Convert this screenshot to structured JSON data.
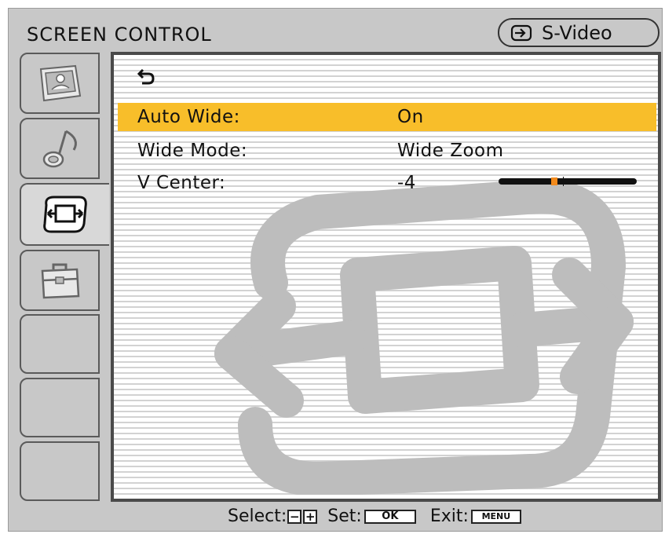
{
  "header": {
    "title": "SCREEN CONTROL",
    "source_icon": "input-arrow-icon",
    "source_label": "S-Video"
  },
  "sidebar": {
    "items": [
      {
        "icon": "picture-icon",
        "active": false
      },
      {
        "icon": "audio-icon",
        "active": false
      },
      {
        "icon": "screen-control-icon",
        "active": true
      },
      {
        "icon": "toolbox-icon",
        "active": false
      },
      {
        "icon": "",
        "active": false
      },
      {
        "icon": "",
        "active": false
      },
      {
        "icon": "",
        "active": false
      }
    ]
  },
  "menu": {
    "back_icon": "return-arrow-icon",
    "rows": [
      {
        "label": "Auto Wide:",
        "value": "On",
        "selected": true
      },
      {
        "label": "Wide Mode:",
        "value": "Wide Zoom",
        "selected": false
      },
      {
        "label": "V Center:",
        "value": "-4",
        "selected": false,
        "slider_level": -4
      }
    ]
  },
  "footer": {
    "select_label": "Select:",
    "minus_key": "−",
    "plus_key": "+",
    "set_label": "Set:",
    "ok_key": "OK",
    "exit_label": "Exit:",
    "menu_key": "MENU"
  },
  "colors": {
    "highlight": "#f8be2a",
    "slider_knob": "#f28a1c",
    "frame": "#c8c8c8"
  }
}
